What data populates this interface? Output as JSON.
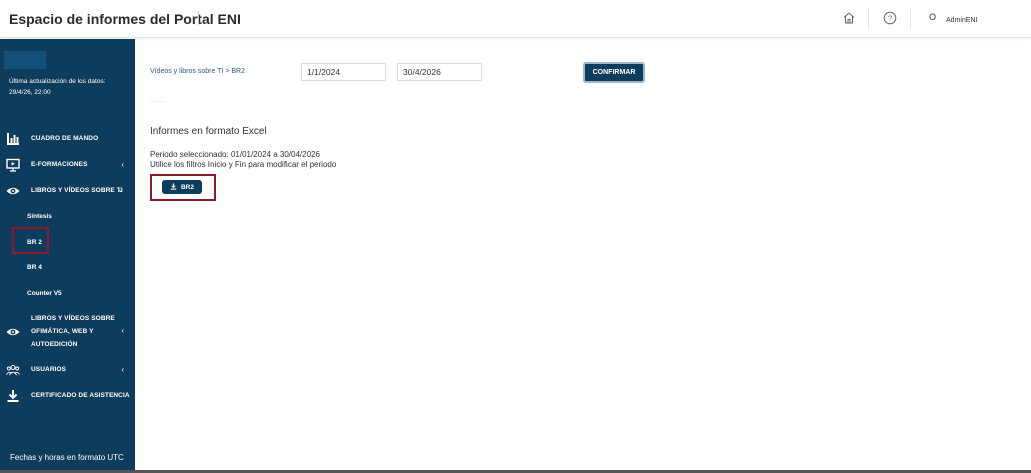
{
  "header": {
    "title": "Espacio de informes del Portal ENI",
    "user_initial": "O",
    "user_name": "AdminENI"
  },
  "icons": {
    "home": "home-icon",
    "help": "help-icon"
  },
  "sidebar": {
    "update_label": "Última actualización de los datos:",
    "update_value": "29/4/26, 22:00",
    "items": [
      {
        "label": "CUADRO DE MANDO",
        "icon": "bar-chart-icon"
      },
      {
        "label": "E-FORMACIONES",
        "icon": "presentation-icon"
      },
      {
        "label": "LIBROS Y VÍDEOS SOBRE TI",
        "icon": "eye-icon"
      },
      {
        "label": "LIBROS Y VÍDEOS SOBRE OFIMÁTICA, WEB Y AUTOEDICIÓN",
        "label_lines": [
          "LIBROS Y VÍDEOS SOBRE",
          "OFIMÁTICA, WEB Y",
          "AUTOEDICIÓN"
        ],
        "icon": "eye-icon"
      },
      {
        "label": "USUARIOS",
        "icon": "users-icon"
      },
      {
        "label": "CERTIFICADO DE ASISTENCIA",
        "icon": "download-icon"
      }
    ],
    "subitems": [
      "Síntesis",
      "BR 2",
      "BR 4",
      "Counter V5"
    ],
    "footer": "Fechas y horas en formato UTC"
  },
  "main": {
    "breadcrumb": "Vídeos y libros sobre TI > BR2",
    "date_start": "1/1/2024",
    "date_end": "30/4/2026",
    "confirm_label": "CONFIRMAR",
    "section_title": "Informes en formato Excel",
    "period_text": "Periodo seleccionado: 01/01/2024 a 30/04/2026",
    "filter_hint": "Utilice los filtros Inicio y Fin para modificar el periodo",
    "download_label": "BR2"
  },
  "colors": {
    "sidebar_bg": "#0e3c5c",
    "highlight_border": "#8b1a2b",
    "button_bg": "#0e3c5c",
    "link": "#2a5a8a"
  }
}
